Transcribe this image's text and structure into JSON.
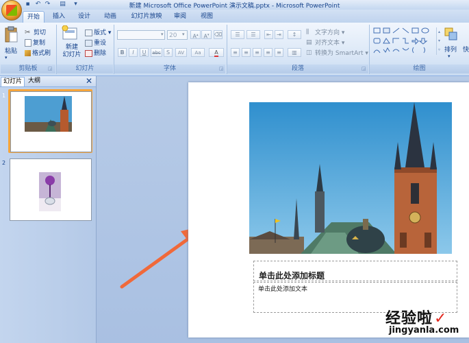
{
  "window": {
    "title": "新建 Microsoft Office PowerPoint 演示文稿.pptx - Microsoft PowerPoint"
  },
  "tabs": [
    "开始",
    "插入",
    "设计",
    "动画",
    "幻灯片放映",
    "审阅",
    "视图"
  ],
  "ribbon": {
    "clipboard": {
      "paste": "粘贴",
      "cut": "剪切",
      "copy": "复制",
      "format_painter": "格式刷",
      "label": "剪贴板"
    },
    "slides": {
      "new_slide": "新建\n幻灯片",
      "layout": "版式",
      "reset": "重设",
      "delete": "删除",
      "label": "幻灯片"
    },
    "font": {
      "font_size": "20",
      "label": "字体"
    },
    "paragraph": {
      "text_direction": "文字方向",
      "align_text": "对齐文本",
      "convert_smartart": "转换为 SmartArt",
      "label": "段落"
    },
    "drawing": {
      "arrange": "排列",
      "quick_styles": "快",
      "label": "绘图"
    }
  },
  "left_pane": {
    "tab_slides": "幻灯片",
    "tab_outline": "大纲",
    "slides": [
      {
        "number": "1",
        "thumb": "church-tower-photo",
        "selected": true
      },
      {
        "number": "2",
        "thumb": "purple-flower-vase-photo",
        "selected": false
      }
    ]
  },
  "slide": {
    "title_placeholder": "单击此处添加标题",
    "body_placeholder": "单击此处添加文本"
  },
  "watermark": {
    "main": "经验啦",
    "check": "✓",
    "sub": "jingyanla.com"
  },
  "colors": {
    "arrow": "#f0693a",
    "selection": "#f6a53b",
    "ribbon_text": "#15428b"
  }
}
